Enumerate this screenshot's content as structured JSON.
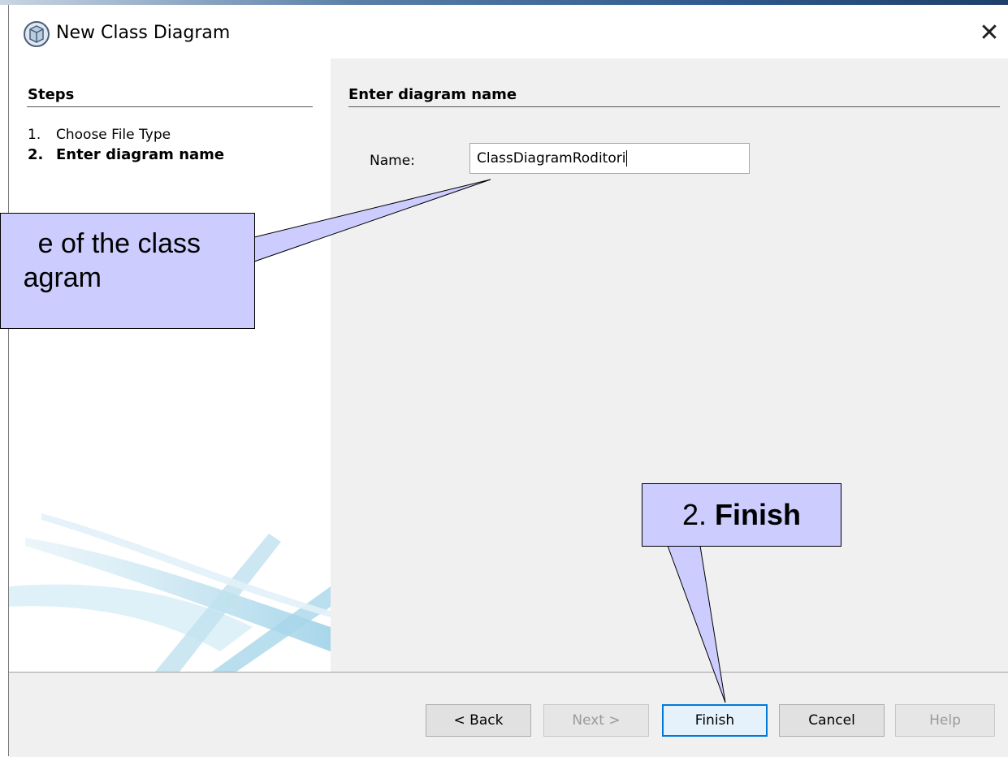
{
  "window": {
    "title": "New Class Diagram",
    "close_glyph": "✕"
  },
  "steps": {
    "heading": "Steps",
    "items": [
      {
        "number": "1.",
        "label": "Choose File Type"
      },
      {
        "number": "2.",
        "label": "Enter diagram name"
      }
    ]
  },
  "panel": {
    "heading": "Enter diagram name",
    "name_label": "Name:",
    "name_value": "ClassDiagramRoditori"
  },
  "buttons": {
    "back": "< Back",
    "next": "Next >",
    "finish": "Finish",
    "cancel": "Cancel",
    "help": "Help"
  },
  "callouts": {
    "name_line1": "e of the class",
    "name_line2": "agram",
    "finish_prefix": "2. ",
    "finish_bold": "Finish"
  },
  "colors": {
    "callout_fill": "#ccccff",
    "focus_accent": "#0078d7",
    "dialog_background": "#f0f0f0"
  },
  "icons": {
    "app": "cube-icon",
    "close": "close-icon"
  }
}
